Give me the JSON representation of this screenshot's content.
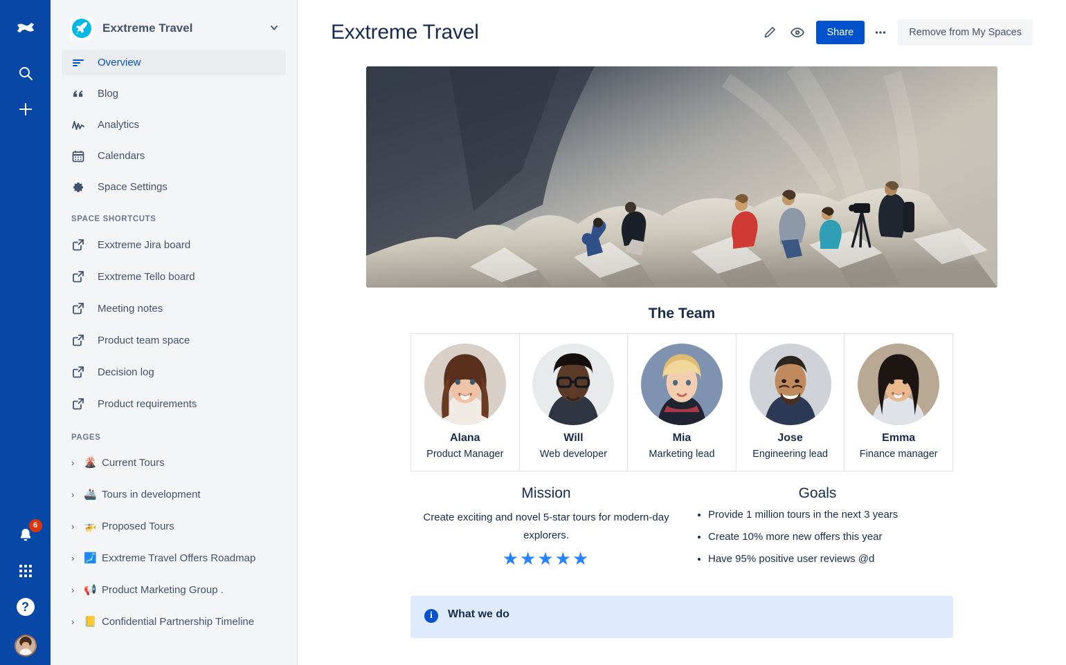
{
  "rail": {
    "logo_icon": "confluence-logo-icon",
    "search_icon": "search-icon",
    "create_icon": "plus-icon",
    "notifications_icon": "bell-icon",
    "notifications_count": "6",
    "apps_icon": "app-switcher-grid-icon",
    "help_icon": "help-question-icon",
    "help_label": "?",
    "avatar_icon": "user-avatar"
  },
  "sidebar": {
    "space_name": "Exxtreme Travel",
    "space_logo_icon": "space-avatar-icon",
    "expand_icon": "chevron-down-icon",
    "nav": [
      {
        "label": "Overview",
        "icon": "overview-lines-icon",
        "active": true
      },
      {
        "label": "Blog",
        "icon": "quote-icon",
        "active": false
      },
      {
        "label": "Analytics",
        "icon": "analytics-chart-icon",
        "active": false
      },
      {
        "label": "Calendars",
        "icon": "calendar-icon",
        "active": false
      },
      {
        "label": "Space Settings",
        "icon": "gear-icon",
        "active": false
      }
    ],
    "shortcuts_label": "SPACE SHORTCUTS",
    "shortcuts": [
      {
        "label": "Exxtreme Jira board",
        "icon": "external-link-icon"
      },
      {
        "label": "Exxtreme Tello board",
        "icon": "external-link-icon"
      },
      {
        "label": "Meeting notes",
        "icon": "external-link-icon"
      },
      {
        "label": "Product team space",
        "icon": "external-link-icon"
      },
      {
        "label": "Decision log",
        "icon": "external-link-icon"
      },
      {
        "label": "Product requirements",
        "icon": "external-link-icon"
      }
    ],
    "pages_label": "PAGES",
    "pages": [
      {
        "label": "Current Tours",
        "emoji": "🌋",
        "chevron": "›"
      },
      {
        "label": "Tours in development",
        "emoji": "🚢",
        "chevron": "›"
      },
      {
        "label": "Proposed Tours",
        "emoji": "🚁",
        "chevron": "›"
      },
      {
        "label": "Exxtreme Travel Offers Roadmap",
        "emoji": "🗾",
        "chevron": "›"
      },
      {
        "label": "Product Marketing Group .",
        "emoji": "📢",
        "chevron": "›"
      },
      {
        "label": "Confidential Partnership Timeline",
        "emoji": "📒",
        "chevron": "›"
      }
    ]
  },
  "header": {
    "title": "Exxtreme Travel",
    "edit_icon": "pencil-edit-icon",
    "watch_icon": "eye-watch-icon",
    "share_label": "Share",
    "more_label": "•••",
    "remove_label": "Remove from My Spaces"
  },
  "content": {
    "hero_alt": "hikers-on-rocky-summit-photo",
    "team_title": "The Team",
    "team": [
      {
        "name": "Alana",
        "role": "Product Manager"
      },
      {
        "name": "Will",
        "role": "Web developer"
      },
      {
        "name": "Mia",
        "role": "Marketing lead"
      },
      {
        "name": "Jose",
        "role": "Engineering lead"
      },
      {
        "name": "Emma",
        "role": "Finance manager"
      }
    ],
    "mission_title": "Mission",
    "mission_text": "Create exciting and novel 5-star tours for modern-day explorers.",
    "mission_stars": "★★★★★",
    "goals_title": "Goals",
    "goals": [
      "Provide 1 million tours in the next 3 years",
      "Create 10% more new offers this year",
      "Have 95% positive user reviews @d"
    ],
    "info_panel_title": "What we do"
  },
  "colors": {
    "rail_blue": "#0747A6",
    "accent_blue": "#0052CC",
    "star_blue": "#2684FF",
    "sidebar_bg": "#F4F5F7",
    "text_dark": "#172B4D",
    "text_muted": "#42526E",
    "badge_red": "#DE350B",
    "info_bg": "#DEEBFF"
  }
}
